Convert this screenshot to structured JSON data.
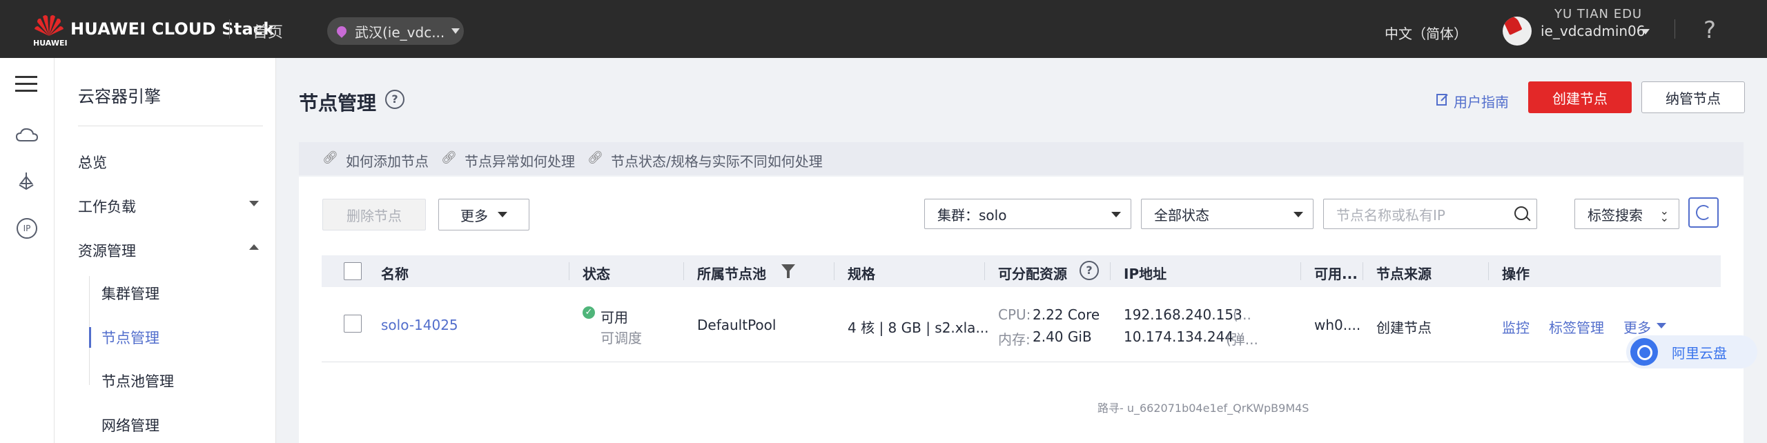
{
  "topbar": {
    "logo_text": "HUAWEI CLOUD Stack",
    "logo_sub": "HUAWEI",
    "home": "首页",
    "region": "武汉(ie_vdc...",
    "language": "中文（简体）",
    "username": "ie_vdcadmin06",
    "help": "?",
    "watermark": "YU TIAN EDU"
  },
  "sidebar": {
    "title": "云容器引擎",
    "items": [
      {
        "label": "总览"
      },
      {
        "label": "工作负载"
      },
      {
        "label": "资源管理"
      }
    ],
    "subitems": [
      {
        "label": "集群管理"
      },
      {
        "label": "节点管理"
      },
      {
        "label": "节点池管理"
      },
      {
        "label": "网络管理"
      }
    ]
  },
  "page": {
    "title": "节点管理",
    "user_guide": "用户指南",
    "create_button": "创建节点",
    "manage_button": "纳管节点"
  },
  "tips": [
    "如何添加节点",
    "节点异常如何处理",
    "节点状态/规格与实际不同如何处理"
  ],
  "toolbar": {
    "delete_button": "删除节点",
    "more_button": "更多",
    "cluster_select": "集群：solo",
    "status_select": "全部状态",
    "search_placeholder": "节点名称或私有IP",
    "tag_search": "标签搜索"
  },
  "table": {
    "columns": [
      "名称",
      "状态",
      "所属节点池",
      "规格",
      "可分配资源",
      "IP地址",
      "可用...",
      "节点来源",
      "操作"
    ],
    "rows": [
      {
        "name": "solo-14025",
        "status": "可用",
        "status_sub": "可调度",
        "pool": "DefaultPool",
        "spec": "4 核 | 8 GB | s2.xla...",
        "cpu_label": "CPU:",
        "cpu_value": "2.22 Core",
        "mem_label": "内存:",
        "mem_value": "2.40 GiB",
        "ip1": "192.168.240.153",
        "ip1_note": "(...",
        "ip2": "10.174.134.244",
        "ip2_note": "(弹...",
        "az": "wh0....",
        "source": "创建节点",
        "actions": [
          "监控",
          "标签管理",
          "更多"
        ]
      }
    ]
  },
  "overlay": {
    "aliyun": "阿里云盘",
    "watermark": "路寻- u_662071b04e1ef_QrKWpB9M4S"
  },
  "colors": {
    "primary": "#526ecc",
    "danger": "#e32828",
    "success": "#4fb57a",
    "topbar": "#2b2b2b"
  }
}
